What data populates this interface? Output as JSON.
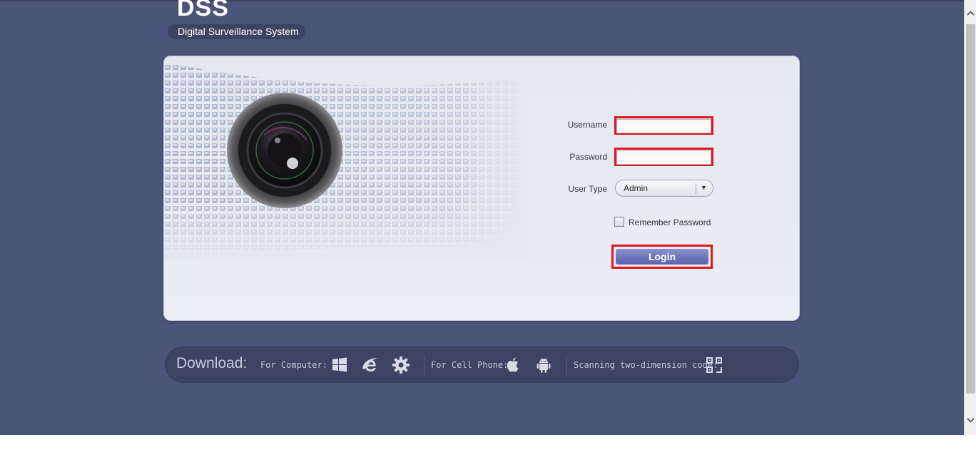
{
  "logo": {
    "title": "DSS",
    "subtitle": "Digital Surveillance System"
  },
  "form": {
    "username_label": "Username",
    "username_value": "",
    "password_label": "Password",
    "password_value": "",
    "user_type_label": "User Type",
    "user_type_value": "Admin",
    "remember_label": "Remember Password",
    "remember_checked": false,
    "login_label": "Login"
  },
  "download": {
    "title": "Download:",
    "computer_label": "For Computer:",
    "computer_icons": [
      "windows-icon",
      "internet-explorer-icon",
      "gear-icon"
    ],
    "phone_label": "For Cell Phone:",
    "phone_icons": [
      "apple-icon",
      "android-icon"
    ],
    "qr_label": "Scanning two-dimension code:",
    "qr_icon": "qr-code-icon"
  },
  "colors": {
    "background": "#4b5479",
    "highlight": "#e3151c",
    "login_button": "#6a74b8"
  }
}
